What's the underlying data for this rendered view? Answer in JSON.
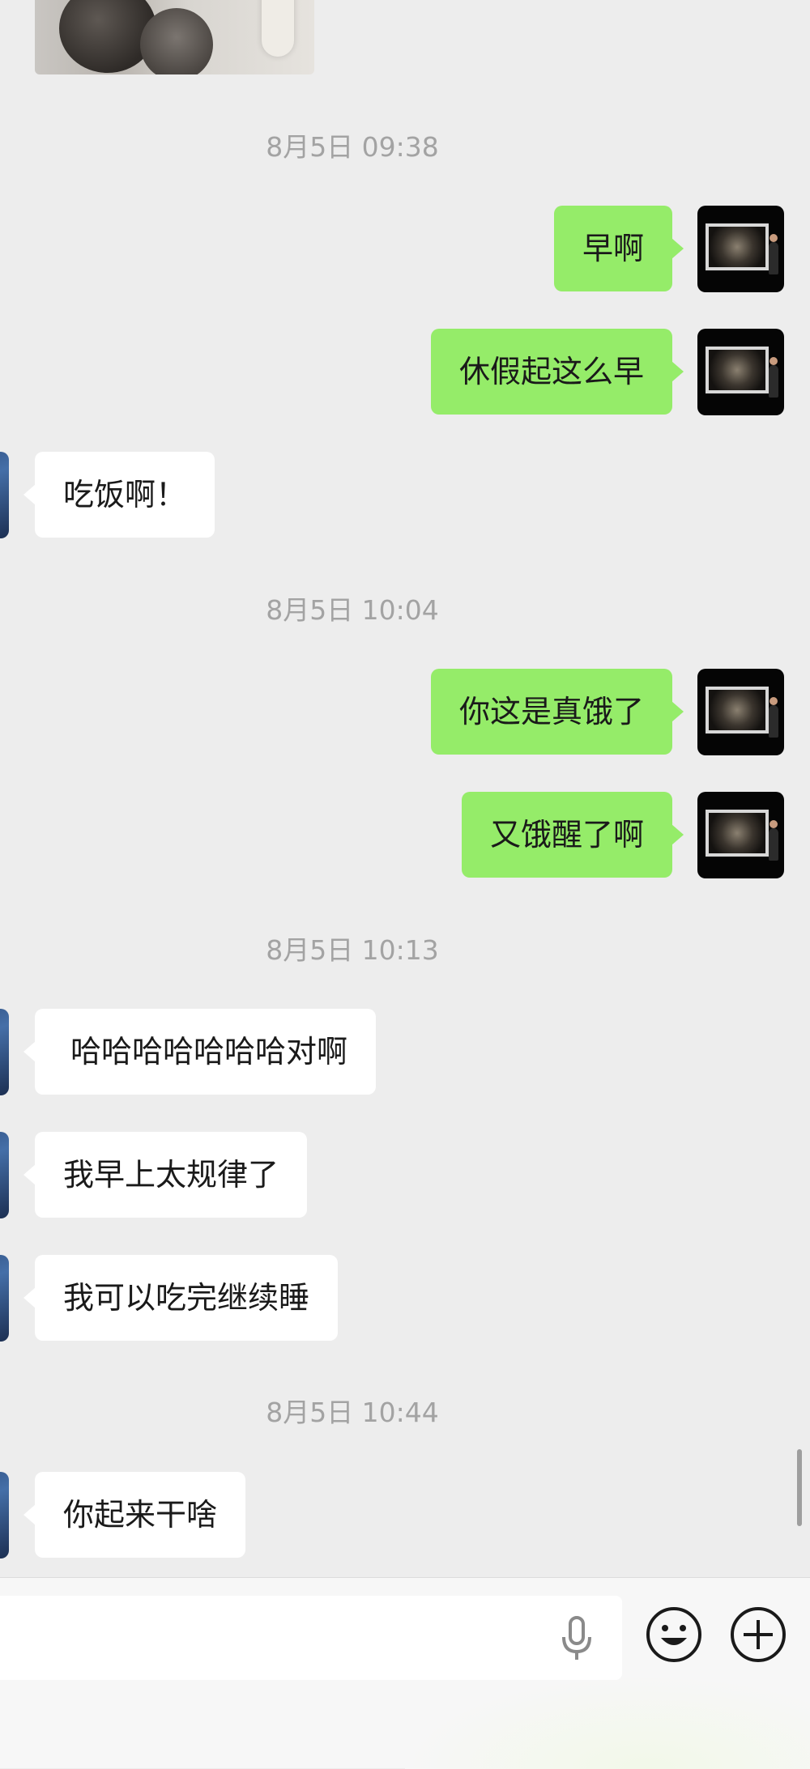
{
  "messages": [
    {
      "kind": "image",
      "sender": "them"
    },
    {
      "kind": "timestamp",
      "text": "8月5日 09:38"
    },
    {
      "kind": "text",
      "sender": "me",
      "text": "早啊"
    },
    {
      "kind": "text",
      "sender": "me",
      "text": "休假起这么早"
    },
    {
      "kind": "text",
      "sender": "them",
      "text": "吃饭啊！"
    },
    {
      "kind": "timestamp",
      "text": "8月5日 10:04"
    },
    {
      "kind": "text",
      "sender": "me",
      "text": "你这是真饿了"
    },
    {
      "kind": "text",
      "sender": "me",
      "text": "又饿醒了啊"
    },
    {
      "kind": "timestamp",
      "text": "8月5日 10:13"
    },
    {
      "kind": "text",
      "sender": "them",
      "text": "哈哈哈哈哈哈哈对啊"
    },
    {
      "kind": "text",
      "sender": "them",
      "text": "我早上太规律了"
    },
    {
      "kind": "text",
      "sender": "them",
      "text": "我可以吃完继续睡"
    },
    {
      "kind": "timestamp",
      "text": "8月5日 10:44"
    },
    {
      "kind": "text",
      "sender": "them",
      "text": "你起来干啥"
    }
  ],
  "input_bar": {
    "input_value": "",
    "icons": [
      "microphone-icon",
      "emoji-icon",
      "plus-icon"
    ]
  },
  "colors": {
    "background": "#ededed",
    "my_bubble": "#95ec69",
    "their_bubble": "#ffffff",
    "timestamp_text": "#a3a3a3"
  }
}
